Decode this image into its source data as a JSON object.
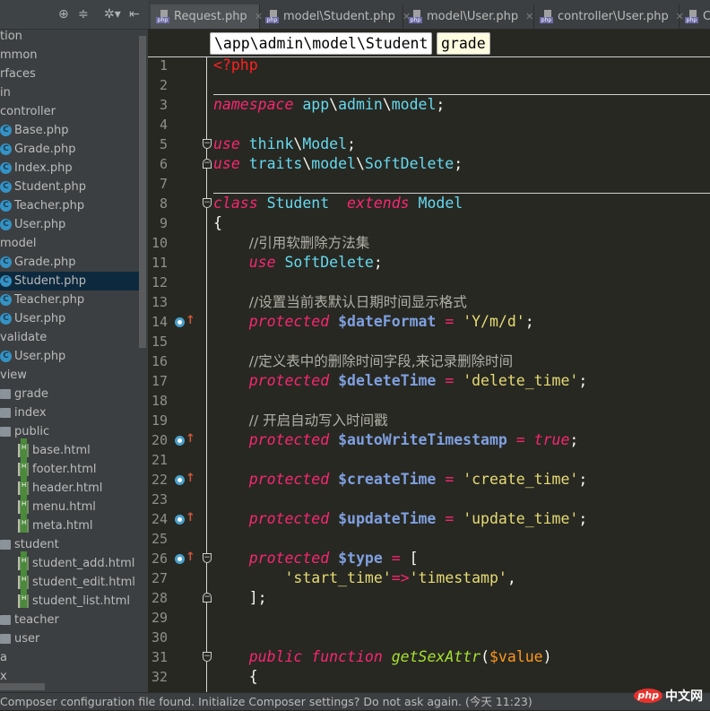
{
  "sidebar": {
    "toolbar_icons": [
      "locate-icon",
      "collapse-icon",
      "gear-icon",
      "hide-icon"
    ],
    "items": [
      {
        "label": "tion",
        "type": "text",
        "indent": 0
      },
      {
        "label": "mmon",
        "type": "text",
        "indent": 0
      },
      {
        "label": "rfaces",
        "type": "text",
        "indent": 0
      },
      {
        "label": "in",
        "type": "text",
        "indent": 0
      },
      {
        "label": "controller",
        "type": "text",
        "indent": 0
      },
      {
        "label": "Base.php",
        "type": "class",
        "indent": 1
      },
      {
        "label": "Grade.php",
        "type": "class",
        "indent": 1
      },
      {
        "label": "Index.php",
        "type": "class",
        "indent": 1
      },
      {
        "label": "Student.php",
        "type": "class",
        "indent": 1
      },
      {
        "label": "Teacher.php",
        "type": "class",
        "indent": 1
      },
      {
        "label": "User.php",
        "type": "class",
        "indent": 1
      },
      {
        "label": "model",
        "type": "text",
        "indent": 0
      },
      {
        "label": "Grade.php",
        "type": "class",
        "indent": 1
      },
      {
        "label": "Student.php",
        "type": "class",
        "indent": 1,
        "selected": true
      },
      {
        "label": "Teacher.php",
        "type": "class",
        "indent": 1
      },
      {
        "label": "User.php",
        "type": "class",
        "indent": 1
      },
      {
        "label": "validate",
        "type": "text",
        "indent": 0
      },
      {
        "label": "User.php",
        "type": "class",
        "indent": 1
      },
      {
        "label": "view",
        "type": "text",
        "indent": 0
      },
      {
        "label": "grade",
        "type": "folder",
        "indent": 1
      },
      {
        "label": "index",
        "type": "folder",
        "indent": 1
      },
      {
        "label": "public",
        "type": "folder",
        "indent": 1
      },
      {
        "label": "base.html",
        "type": "html",
        "indent": 2
      },
      {
        "label": "footer.html",
        "type": "html",
        "indent": 2
      },
      {
        "label": "header.html",
        "type": "html",
        "indent": 2
      },
      {
        "label": "menu.html",
        "type": "html",
        "indent": 2
      },
      {
        "label": "meta.html",
        "type": "html",
        "indent": 2
      },
      {
        "label": "student",
        "type": "folder",
        "indent": 1
      },
      {
        "label": "student_add.html",
        "type": "html",
        "indent": 2
      },
      {
        "label": "student_edit.html",
        "type": "html",
        "indent": 2
      },
      {
        "label": "student_list.html",
        "type": "html",
        "indent": 2
      },
      {
        "label": "teacher",
        "type": "folder",
        "indent": 1
      },
      {
        "label": "user",
        "type": "folder",
        "indent": 1
      },
      {
        "label": "a",
        "type": "text",
        "indent": 0
      },
      {
        "label": "x",
        "type": "text",
        "indent": 0
      }
    ]
  },
  "tabs": [
    {
      "label": "Request.php",
      "active": true
    },
    {
      "label": "model\\Student.php"
    },
    {
      "label": "model\\User.php"
    },
    {
      "label": "controller\\User.php"
    },
    {
      "label": "C"
    }
  ],
  "breadcrumb": {
    "path": "\\app\\admin\\model\\Student",
    "member": "grade"
  },
  "editor": {
    "lines": [
      [
        [
          "tag",
          "<?php"
        ]
      ],
      [],
      [
        [
          "kw",
          "namespace"
        ],
        [
          "p",
          " "
        ],
        [
          "ns",
          "app"
        ],
        [
          "p",
          "\\"
        ],
        [
          "ns",
          "admin"
        ],
        [
          "p",
          "\\"
        ],
        [
          "ns",
          "model"
        ],
        [
          "p",
          ";"
        ]
      ],
      [],
      [
        [
          "kw",
          "use"
        ],
        [
          "p",
          " "
        ],
        [
          "ns",
          "think"
        ],
        [
          "p",
          "\\"
        ],
        [
          "ns",
          "Model"
        ],
        [
          "p",
          ";"
        ]
      ],
      [
        [
          "kw",
          "use"
        ],
        [
          "p",
          " "
        ],
        [
          "ns",
          "traits"
        ],
        [
          "p",
          "\\"
        ],
        [
          "ns",
          "model"
        ],
        [
          "p",
          "\\"
        ],
        [
          "ns",
          "SoftDelete"
        ],
        [
          "p",
          ";"
        ]
      ],
      [],
      [
        [
          "kw",
          "class"
        ],
        [
          "p",
          " "
        ],
        [
          "cls",
          "Student"
        ],
        [
          "p",
          "  "
        ],
        [
          "kw",
          "extends"
        ],
        [
          "p",
          " "
        ],
        [
          "cls",
          "Model"
        ]
      ],
      [
        [
          "p",
          "{"
        ]
      ],
      [
        [
          "p",
          "    "
        ],
        [
          "cm",
          "//引用软删除方法集"
        ]
      ],
      [
        [
          "p",
          "    "
        ],
        [
          "kw",
          "use"
        ],
        [
          "p",
          " "
        ],
        [
          "cls",
          "SoftDelete"
        ],
        [
          "p",
          ";"
        ]
      ],
      [],
      [
        [
          "p",
          "    "
        ],
        [
          "cm",
          "//设置当前表默认日期时间显示格式"
        ]
      ],
      [
        [
          "p",
          "    "
        ],
        [
          "kw",
          "protected"
        ],
        [
          "p",
          " "
        ],
        [
          "var",
          "$dateFormat"
        ],
        [
          "p",
          " "
        ],
        [
          "op",
          "="
        ],
        [
          "p",
          " "
        ],
        [
          "str",
          "'Y/m/d'"
        ],
        [
          "p",
          ";"
        ]
      ],
      [],
      [
        [
          "p",
          "    "
        ],
        [
          "cm",
          "//定义表中的删除时间字段,来记录删除时间"
        ]
      ],
      [
        [
          "p",
          "    "
        ],
        [
          "kw",
          "protected"
        ],
        [
          "p",
          " "
        ],
        [
          "var",
          "$deleteTime"
        ],
        [
          "p",
          " "
        ],
        [
          "op",
          "="
        ],
        [
          "p",
          " "
        ],
        [
          "str",
          "'delete_time'"
        ],
        [
          "p",
          ";"
        ]
      ],
      [],
      [
        [
          "p",
          "    "
        ],
        [
          "cm",
          "// 开启自动写入时间戳"
        ]
      ],
      [
        [
          "p",
          "    "
        ],
        [
          "kw",
          "protected"
        ],
        [
          "p",
          " "
        ],
        [
          "var",
          "$autoWriteTimestamp"
        ],
        [
          "p",
          " "
        ],
        [
          "op",
          "="
        ],
        [
          "p",
          " "
        ],
        [
          "kw",
          "true"
        ],
        [
          "p",
          ";"
        ]
      ],
      [],
      [
        [
          "p",
          "    "
        ],
        [
          "kw",
          "protected"
        ],
        [
          "p",
          " "
        ],
        [
          "var",
          "$createTime"
        ],
        [
          "p",
          " "
        ],
        [
          "op",
          "="
        ],
        [
          "p",
          " "
        ],
        [
          "str",
          "'create_time'"
        ],
        [
          "p",
          ";"
        ]
      ],
      [],
      [
        [
          "p",
          "    "
        ],
        [
          "kw",
          "protected"
        ],
        [
          "p",
          " "
        ],
        [
          "var",
          "$updateTime"
        ],
        [
          "p",
          " "
        ],
        [
          "op",
          "="
        ],
        [
          "p",
          " "
        ],
        [
          "str",
          "'update_time'"
        ],
        [
          "p",
          ";"
        ]
      ],
      [],
      [
        [
          "p",
          "    "
        ],
        [
          "kw",
          "protected"
        ],
        [
          "p",
          " "
        ],
        [
          "var",
          "$type"
        ],
        [
          "p",
          " "
        ],
        [
          "op",
          "="
        ],
        [
          "p",
          " ["
        ]
      ],
      [
        [
          "p",
          "        "
        ],
        [
          "str",
          "'start_time'"
        ],
        [
          "op",
          "=>"
        ],
        [
          "str",
          "'timestamp'"
        ],
        [
          "p",
          ","
        ]
      ],
      [
        [
          "p",
          "    ];"
        ]
      ],
      [],
      [],
      [
        [
          "p",
          "    "
        ],
        [
          "kw",
          "public"
        ],
        [
          "p",
          " "
        ],
        [
          "kw",
          "function"
        ],
        [
          "p",
          " "
        ],
        [
          "fn",
          "getSexAttr"
        ],
        [
          "p",
          "("
        ],
        [
          "param",
          "$value"
        ],
        [
          "p",
          ")"
        ]
      ],
      [
        [
          "p",
          "    {"
        ]
      ]
    ],
    "override_lines": [
      14,
      20,
      22,
      24,
      26
    ],
    "fold_lines": [
      {
        "line": 5,
        "kind": "start"
      },
      {
        "line": 6,
        "kind": "end"
      },
      {
        "line": 8,
        "kind": "start"
      },
      {
        "line": 26,
        "kind": "start"
      },
      {
        "line": 28,
        "kind": "end"
      },
      {
        "line": 31,
        "kind": "start"
      }
    ],
    "separator_before_lines": [
      3,
      8
    ]
  },
  "status": {
    "message": "Composer configuration file found. Initialize Composer settings? Do not ask again. (今天 11:23)"
  },
  "watermark": {
    "logo": "php",
    "text": "中文网"
  }
}
